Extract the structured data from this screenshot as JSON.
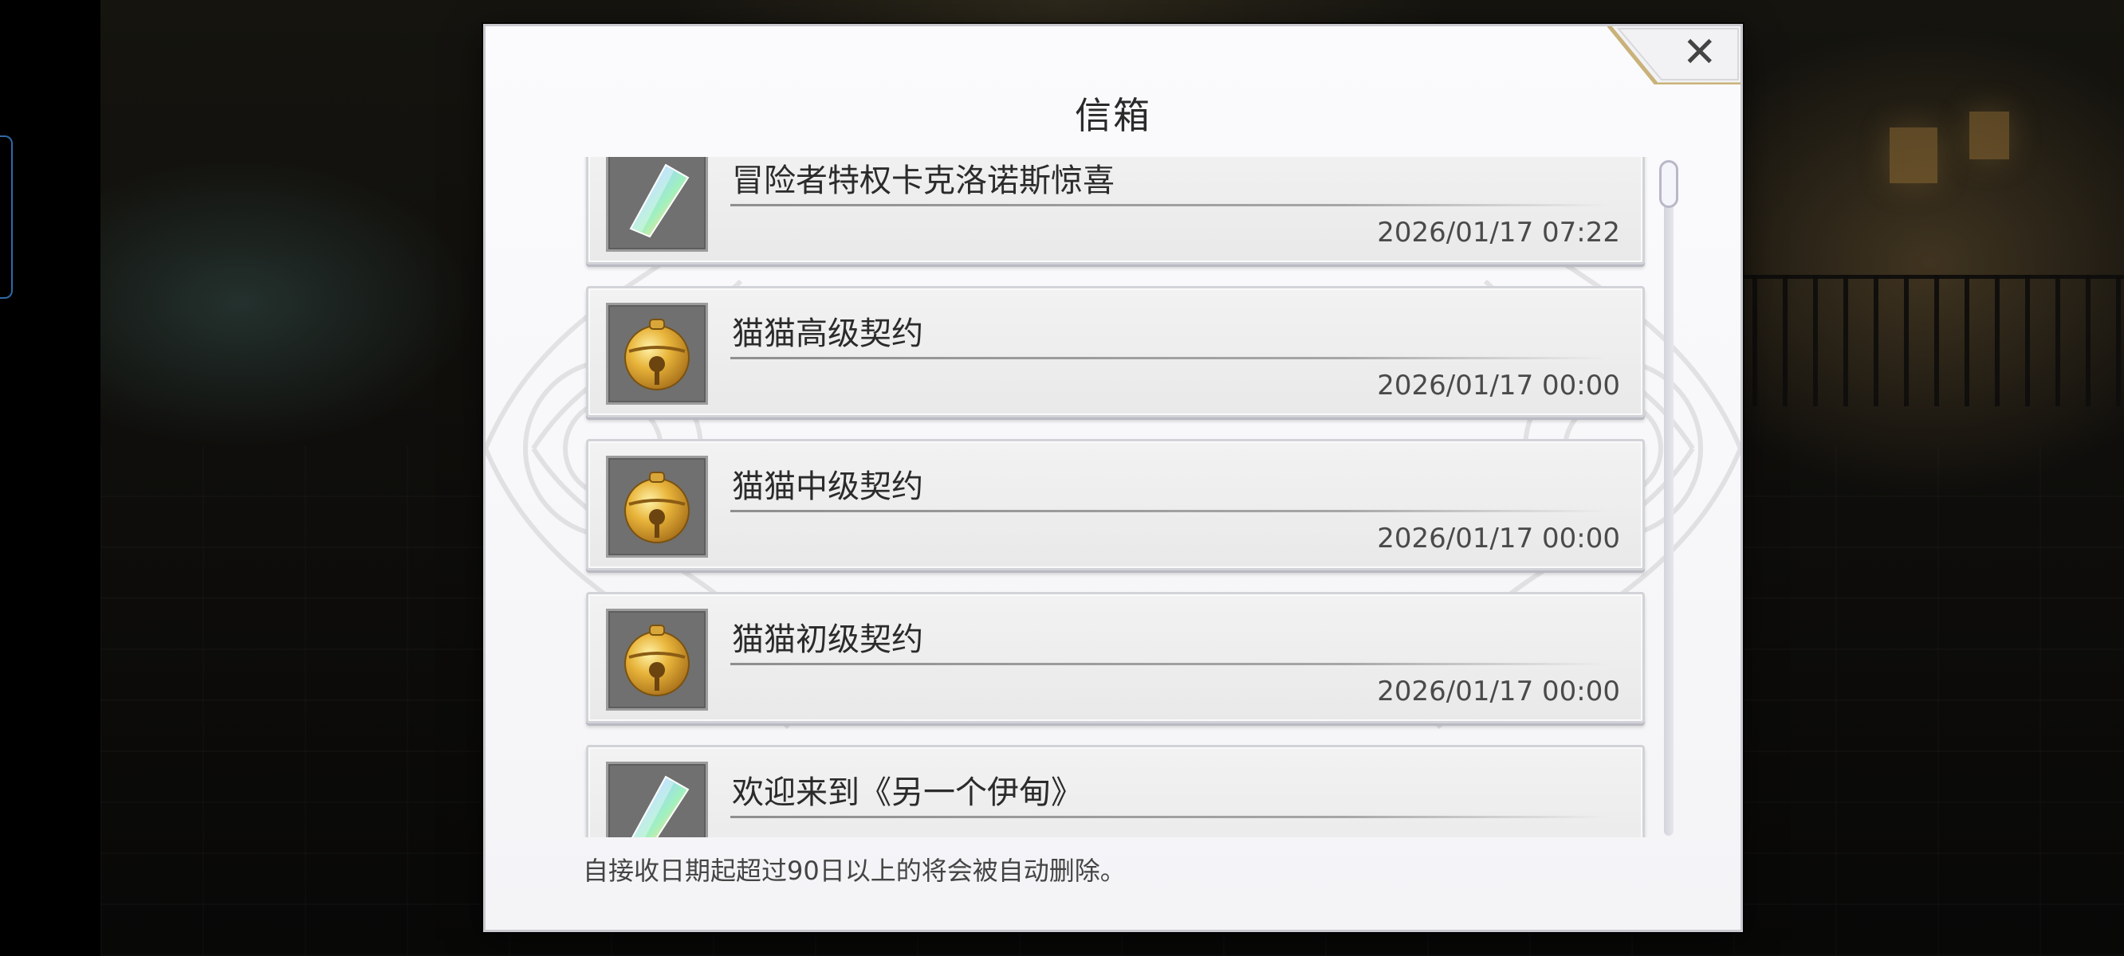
{
  "dialog": {
    "title": "信箱",
    "close_icon": "close-icon",
    "footer_note": "自接收日期起超过90日以上的将会被自动删除。"
  },
  "mails": [
    {
      "title": "冒险者特权卡克洛诺斯惊喜",
      "date": "2026/01/17 07:22",
      "icon": "crystal-icon"
    },
    {
      "title": "猫猫高级契约",
      "date": "2026/01/17 00:00",
      "icon": "gold-bell-icon"
    },
    {
      "title": "猫猫中级契约",
      "date": "2026/01/17 00:00",
      "icon": "gold-bell-icon"
    },
    {
      "title": "猫猫初级契约",
      "date": "2026/01/17 00:00",
      "icon": "gold-bell-icon"
    },
    {
      "title": "欢迎来到《另一个伊甸》",
      "date": "",
      "icon": "crystal-icon"
    }
  ],
  "colors": {
    "panel": "#f7f7fa",
    "frame_gold": "#c9b27a",
    "icon_bg": "#707070",
    "bell_gold": "#e3b23a"
  }
}
